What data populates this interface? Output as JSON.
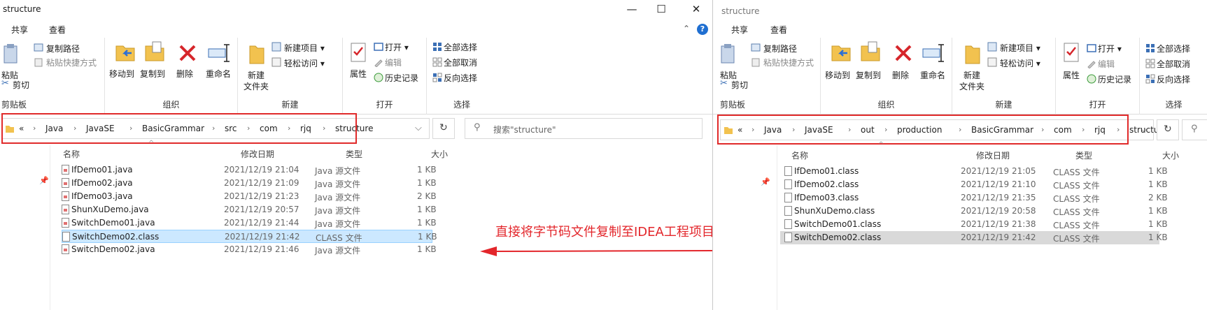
{
  "colors": {
    "accent": "#1f6fd1",
    "highlight_red": "#e02a2a",
    "selected_row": "#cce8ff",
    "selected_row_inactive": "#d9d9d9"
  },
  "annotation": "直接将字节码文件复制至IDEA工程项目路径下面",
  "left": {
    "title": "structure",
    "tabs": [
      "共享",
      "查看"
    ],
    "ribbon": {
      "clipboard": {
        "paste": "粘贴",
        "copy_path": "复制路径",
        "paste_shortcut": "粘贴快捷方式",
        "cut": "剪切",
        "group": "剪贴板"
      },
      "organize": {
        "move_to": "移动到",
        "copy_to": "复制到",
        "delete": "删除",
        "rename": "重命名",
        "group": "组织"
      },
      "new": {
        "new_folder": "新建\n文件夹",
        "new_item": "新建项目 ▾",
        "easy_access": "轻松访问 ▾",
        "group": "新建"
      },
      "open": {
        "properties": "属性",
        "open": "打开 ▾",
        "edit": "编辑",
        "history": "历史记录",
        "group": "打开"
      },
      "select": {
        "select_all": "全部选择",
        "select_none": "全部取消",
        "invert": "反向选择",
        "group": "选择"
      }
    },
    "breadcrumb": [
      "«",
      "Java",
      "JavaSE",
      "BasicGrammar",
      "src",
      "com",
      "rjq",
      "structure"
    ],
    "search_placeholder": "搜索\"structure\"",
    "columns": [
      "名称",
      "修改日期",
      "类型",
      "大小"
    ],
    "files": [
      {
        "name": "IfDemo01.java",
        "date": "2021/12/19 21:04",
        "type": "Java 源文件",
        "size": "1 KB",
        "kind": "java"
      },
      {
        "name": "IfDemo02.java",
        "date": "2021/12/19 21:09",
        "type": "Java 源文件",
        "size": "1 KB",
        "kind": "java"
      },
      {
        "name": "IfDemo03.java",
        "date": "2021/12/19 21:23",
        "type": "Java 源文件",
        "size": "2 KB",
        "kind": "java"
      },
      {
        "name": "ShunXuDemo.java",
        "date": "2021/12/19 20:57",
        "type": "Java 源文件",
        "size": "1 KB",
        "kind": "java"
      },
      {
        "name": "SwitchDemo01.java",
        "date": "2021/12/19 21:44",
        "type": "Java 源文件",
        "size": "1 KB",
        "kind": "java"
      },
      {
        "name": "SwitchDemo02.class",
        "date": "2021/12/19 21:42",
        "type": "CLASS 文件",
        "size": "1 KB",
        "kind": "class",
        "selected": true
      },
      {
        "name": "SwitchDemo02.java",
        "date": "2021/12/19 21:46",
        "type": "Java 源文件",
        "size": "1 KB",
        "kind": "java"
      }
    ]
  },
  "right": {
    "title": "structure",
    "tabs": [
      "共享",
      "查看"
    ],
    "breadcrumb": [
      "«",
      "Java",
      "JavaSE",
      "out",
      "production",
      "BasicGrammar",
      "com",
      "rjq",
      "structure"
    ],
    "columns": [
      "名称",
      "修改日期",
      "类型",
      "大小"
    ],
    "files": [
      {
        "name": "IfDemo01.class",
        "date": "2021/12/19 21:05",
        "type": "CLASS 文件",
        "size": "1 KB"
      },
      {
        "name": "IfDemo02.class",
        "date": "2021/12/19 21:10",
        "type": "CLASS 文件",
        "size": "1 KB"
      },
      {
        "name": "IfDemo03.class",
        "date": "2021/12/19 21:35",
        "type": "CLASS 文件",
        "size": "2 KB"
      },
      {
        "name": "ShunXuDemo.class",
        "date": "2021/12/19 20:58",
        "type": "CLASS 文件",
        "size": "1 KB"
      },
      {
        "name": "SwitchDemo01.class",
        "date": "2021/12/19 21:38",
        "type": "CLASS 文件",
        "size": "1 KB"
      },
      {
        "name": "SwitchDemo02.class",
        "date": "2021/12/19 21:42",
        "type": "CLASS 文件",
        "size": "1 KB",
        "selected": true
      }
    ]
  }
}
